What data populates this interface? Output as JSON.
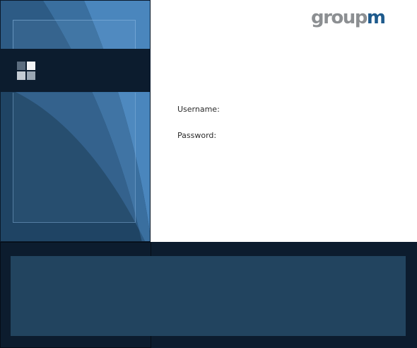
{
  "brand": {
    "logo_part_a": "group",
    "logo_part_b": "m"
  },
  "login_form": {
    "username_label": "Username:",
    "password_label": "Password:"
  },
  "colors": {
    "dark_navy": "#0c1c2e",
    "panel_blue": "#22445f",
    "accent_blue": "#4a86bd",
    "logo_gray": "#8c8f92",
    "logo_blue": "#1e5a8c"
  },
  "icons": {
    "header_icon": "four-squares-icon"
  }
}
